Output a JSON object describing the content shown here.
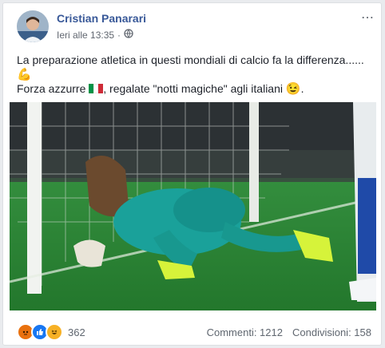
{
  "post": {
    "author": "Cristian Panarari",
    "timestamp": "Ieri alle 13:35",
    "separator": "·",
    "more_icon": "⋯",
    "text_line1": "La preparazione atletica in questi mondiali di calcio fa la differenza......",
    "emoji1": "💪",
    "text_line3a": "Forza azzurre ",
    "text_line3b": ", regalate \"notti magiche\" agli italiani ",
    "emoji2": "😉",
    "text_line3c": "."
  },
  "reactions": {
    "count": "362",
    "comments": "Commenti: 1212",
    "shares": "Condivisioni: 158"
  },
  "colors": {
    "author": "#385898",
    "pitch": "#2f8d3a",
    "jersey": "#1aa19a"
  },
  "icons": [
    "globe-icon",
    "angry-reaction-icon",
    "like-reaction-icon",
    "haha-reaction-icon"
  ]
}
